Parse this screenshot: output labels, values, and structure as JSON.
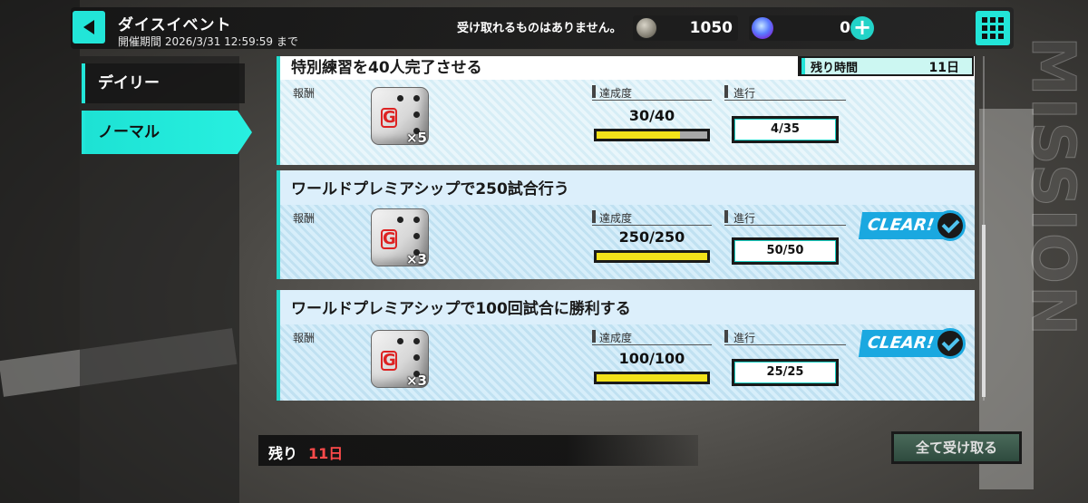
{
  "header": {
    "title": "ダイスイベント",
    "period": "開催期間 2026/3/31 12:59:59 まで",
    "notice": "受け取れるものはありません。",
    "coins": "1050",
    "gems": "0",
    "back_icon": "back-arrow-icon",
    "menu_icon": "grid-menu-icon"
  },
  "sidebar": {
    "items": [
      {
        "label": "デイリー",
        "active": false
      },
      {
        "label": "ノーマル",
        "active": true
      }
    ]
  },
  "watermark": "MISSION",
  "labels": {
    "reward": "報酬",
    "achievement": "達成度",
    "progress": "進行",
    "remaining_time": "残り時間",
    "clear": "CLEAR!"
  },
  "remaining_time_value": "11日",
  "missions": [
    {
      "title": "特別練習を40人完了させる",
      "reward_qty": "×5",
      "achievement": "30/40",
      "achievement_ratio": 0.75,
      "progress": "4/35",
      "cleared": false
    },
    {
      "title": "ワールドプレミアシップで250試合行う",
      "reward_qty": "×3",
      "achievement": "250/250",
      "achievement_ratio": 1.0,
      "progress": "50/50",
      "cleared": true
    },
    {
      "title": "ワールドプレミアシップで100回試合に勝利する",
      "reward_qty": "×3",
      "achievement": "100/100",
      "achievement_ratio": 1.0,
      "progress": "25/25",
      "cleared": true
    }
  ],
  "footer": {
    "remaining_label": "残り",
    "remaining_value": "11日",
    "claim_all": "全て受け取る"
  },
  "colors": {
    "accent": "#22e5d8",
    "clear_blue": "#1aa8e0",
    "bar_yellow": "#f2e21a",
    "remaining_red": "#ff4a4a"
  }
}
